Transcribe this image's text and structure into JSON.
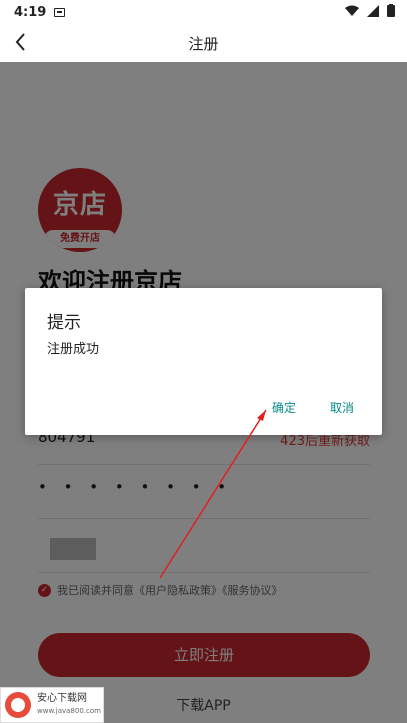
{
  "status_bar": {
    "time": "4:19"
  },
  "header": {
    "title": "注册"
  },
  "logo": {
    "brand": "京店",
    "ribbon": "免费开店"
  },
  "welcome": "欢迎注册京店",
  "form": {
    "code_value": "804791",
    "code_resend": "423后重新获取",
    "password_dots": "• • • • • • • •",
    "agree_text": "我已阅读并同意《用户隐私政策》《服务协议》"
  },
  "register_button": "立即注册",
  "download_link": "下载APP",
  "dialog": {
    "title": "提示",
    "message": "注册成功",
    "ok_label": "确定",
    "cancel_label": "取消"
  },
  "watermark": {
    "name": "安心下载网",
    "url": "www.java800.com"
  },
  "colors": {
    "brand_red": "#c9262c",
    "dialog_button": "#0a8a8a",
    "annotation": "#e02020"
  }
}
